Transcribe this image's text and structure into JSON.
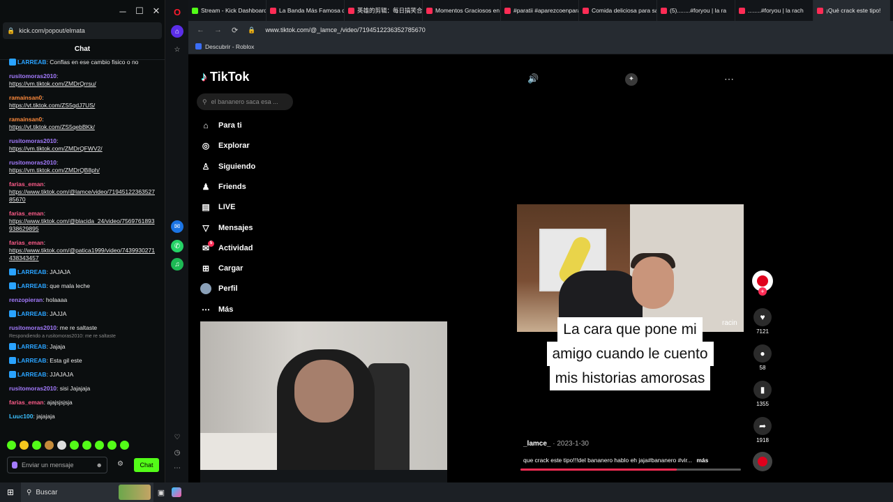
{
  "kick": {
    "url": "kick.com/popout/elmata",
    "chat_title": "Chat",
    "messages": [
      {
        "user": "LARREAB",
        "color": "#2aa3ff",
        "badge": true,
        "text": "Conflas en ese cambio fisico o no",
        "link": false
      },
      {
        "user": "rusitomoras2010",
        "color": "#a47bff",
        "badge": false,
        "text": "https://vm.tiktok.com/ZMDrQrrsu/",
        "link": true
      },
      {
        "user": "ramainsan0",
        "color": "#ff8a3c",
        "badge": false,
        "text": "https://vt.tiktok.com/ZS5qdJ7US/",
        "link": true
      },
      {
        "user": "ramainsan0",
        "color": "#ff8a3c",
        "badge": false,
        "text": "https://vt.tiktok.com/ZS5qebBKk/",
        "link": true
      },
      {
        "user": "rusitomoras2010",
        "color": "#a47bff",
        "badge": false,
        "text": "https://vm.tiktok.com/ZMDrQFWV2/",
        "link": true
      },
      {
        "user": "rusitomoras2010",
        "color": "#a47bff",
        "badge": false,
        "text": "https://vm.tiktok.com/ZMDrQB8ph/",
        "link": true
      },
      {
        "user": "farias_eman",
        "color": "#ff5c8a",
        "badge": false,
        "text": "https://www.tiktok.com/@lamce/video/7194512236352785670",
        "link": true
      },
      {
        "user": "farias_eman",
        "color": "#ff5c8a",
        "badge": false,
        "text": "https://www.tiktok.com/@blacida_24/video/7569761893938629895",
        "link": true
      },
      {
        "user": "farias_eman",
        "color": "#ff5c8a",
        "badge": false,
        "text": "https://www.tiktok.com/@patica1999/video/7439930271438343457",
        "link": true
      },
      {
        "user": "LARREAB",
        "color": "#2aa3ff",
        "badge": true,
        "text": "JAJAJA",
        "link": false
      },
      {
        "user": "LARREAB",
        "color": "#2aa3ff",
        "badge": true,
        "text": "que mala leche",
        "link": false
      },
      {
        "user": "renzopieran",
        "color": "#a47bff",
        "badge": false,
        "text": "holaaaa",
        "link": false
      },
      {
        "user": "LARREAB",
        "color": "#2aa3ff",
        "badge": true,
        "text": "JAJJA",
        "link": false
      },
      {
        "user": "rusitomoras2010",
        "color": "#a47bff",
        "badge": false,
        "text": "me re saltaste",
        "link": false
      }
    ],
    "reply_note": "Respondiendo a rusitomoras2010: me re saltaste",
    "messages2": [
      {
        "user": "LARREAB",
        "color": "#2aa3ff",
        "badge": true,
        "text": "Jajaja"
      },
      {
        "user": "LARREAB",
        "color": "#2aa3ff",
        "badge": true,
        "text": "Esta gil este"
      },
      {
        "user": "LARREAB",
        "color": "#2aa3ff",
        "badge": true,
        "text": "JJAJAJA"
      },
      {
        "user": "rusitomoras2010",
        "color": "#a47bff",
        "badge": false,
        "text": "sisi Jajajaja"
      },
      {
        "user": "farias_eman",
        "color": "#ff5c8a",
        "badge": false,
        "text": "ajajsjsjsja"
      },
      {
        "user": "Luuc100",
        "color": "#3cc0ff",
        "badge": false,
        "text": "jajajaja"
      }
    ],
    "input_placeholder": "Enviar un mensaje",
    "send_label": "Chat"
  },
  "browser": {
    "tabs": [
      {
        "label": "Stream - Kick Dashboard",
        "color": "#53fc18",
        "active": false
      },
      {
        "label": "La Banda Más Famosa de",
        "color": "#fe2c55",
        "active": false
      },
      {
        "label": "英雄的剪辑：每日搞笑合",
        "color": "#fe2c55",
        "active": false
      },
      {
        "label": "Momentos Graciosos en F",
        "color": "#fe2c55",
        "active": false
      },
      {
        "label": "#paratii #aparezcoenpara",
        "color": "#fe2c55",
        "active": false
      },
      {
        "label": "Comida deliciosa para sac",
        "color": "#fe2c55",
        "active": false
      },
      {
        "label": "(5)........#foryou | la ra",
        "color": "#fe2c55",
        "active": false
      },
      {
        "label": "........#foryou | la rach",
        "color": "#fe2c55",
        "active": false
      },
      {
        "label": "¡Qué crack este tipo!",
        "color": "#fe2c55",
        "active": true
      }
    ],
    "url": "www.tiktok.com/@_lamce_/video/7194512236352785670",
    "bookmark": "Descubrir - Roblox"
  },
  "tiktok": {
    "logo": "TikTok",
    "search_placeholder": "el bananero saca esa ...",
    "nav": [
      {
        "label": "Para ti",
        "icon": "home-icon"
      },
      {
        "label": "Explorar",
        "icon": "compass-icon"
      },
      {
        "label": "Siguiendo",
        "icon": "following-icon"
      },
      {
        "label": "Friends",
        "icon": "friends-icon"
      },
      {
        "label": "LIVE",
        "icon": "live-icon"
      },
      {
        "label": "Mensajes",
        "icon": "messages-icon"
      },
      {
        "label": "Actividad",
        "icon": "activity-icon",
        "badge": "5"
      },
      {
        "label": "Cargar",
        "icon": "upload-icon"
      },
      {
        "label": "Perfil",
        "icon": "profile-icon"
      },
      {
        "label": "Más",
        "icon": "more-icon"
      }
    ],
    "caption_lines": [
      "La cara que pone mi",
      "amigo cuando le cuento",
      "mis historias amorosas"
    ],
    "video_overlay_text": "racin",
    "likes": "7121",
    "comments": "58",
    "saves": "1355",
    "shares": "1918",
    "author": "_lamce_",
    "date": "2023-1-30",
    "description": "que crack este tipo!!!del bananero hablo eh jaja#bananero #vir...",
    "more_label": "más",
    "progress": 0.71
  },
  "taskbar": {
    "search_label": "Buscar"
  }
}
